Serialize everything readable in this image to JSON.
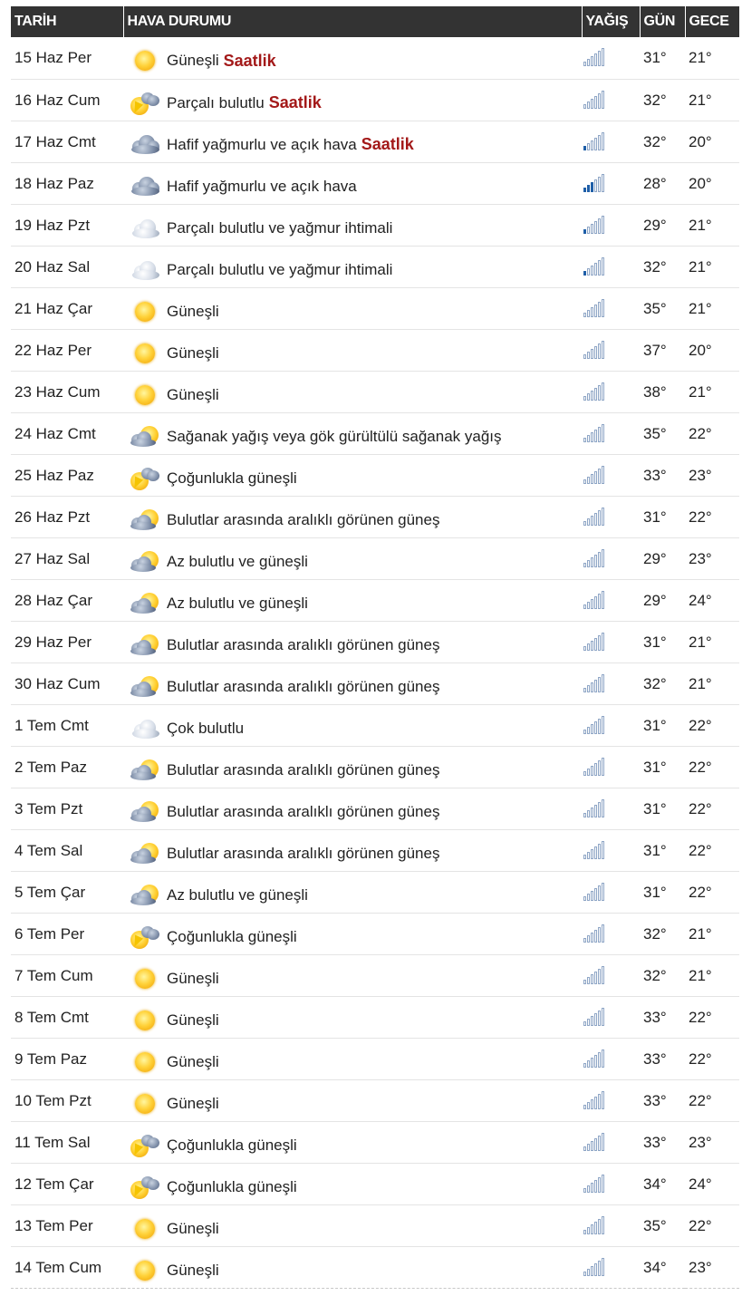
{
  "headers": {
    "date": "TARİH",
    "condition": "HAVA DURUMU",
    "rain": "YAĞIŞ",
    "day": "GÜN",
    "night": "GECE"
  },
  "hourly_link": "Saatlik",
  "rows": [
    {
      "date": "15 Haz Per",
      "icon": "sun-icon",
      "condition": "Güneşli",
      "hourly": true,
      "rain": 0,
      "day": "31°",
      "night": "21°"
    },
    {
      "date": "16 Haz Cum",
      "icon": "sun-cloud-storm-icon",
      "condition": "Parçalı bulutlu",
      "hourly": true,
      "rain": 0,
      "day": "32°",
      "night": "21°"
    },
    {
      "date": "17 Haz Cmt",
      "icon": "rain-cloud-icon",
      "condition": "Hafif yağmurlu ve açık hava",
      "hourly": true,
      "rain": 1,
      "day": "32°",
      "night": "20°"
    },
    {
      "date": "18 Haz Paz",
      "icon": "rain-cloud-icon",
      "condition": "Hafif yağmurlu ve açık hava",
      "hourly": false,
      "rain": 3,
      "day": "28°",
      "night": "20°"
    },
    {
      "date": "19 Haz Pzt",
      "icon": "cloud-icon",
      "condition": "Parçalı bulutlu ve yağmur ihtimali",
      "hourly": false,
      "rain": 1,
      "day": "29°",
      "night": "21°"
    },
    {
      "date": "20 Haz Sal",
      "icon": "cloud-icon",
      "condition": "Parçalı bulutlu ve yağmur ihtimali",
      "hourly": false,
      "rain": 1,
      "day": "32°",
      "night": "21°"
    },
    {
      "date": "21 Haz Çar",
      "icon": "sun-icon",
      "condition": "Güneşli",
      "hourly": false,
      "rain": 0,
      "day": "35°",
      "night": "21°"
    },
    {
      "date": "22 Haz Per",
      "icon": "sun-icon",
      "condition": "Güneşli",
      "hourly": false,
      "rain": 0,
      "day": "37°",
      "night": "20°"
    },
    {
      "date": "23 Haz Cum",
      "icon": "sun-icon",
      "condition": "Güneşli",
      "hourly": false,
      "rain": 0,
      "day": "38°",
      "night": "21°"
    },
    {
      "date": "24 Haz Cmt",
      "icon": "sun-dark-cloud-icon",
      "condition": "Sağanak yağış veya gök gürültülü sağanak yağış",
      "hourly": false,
      "rain": 0,
      "day": "35°",
      "night": "22°"
    },
    {
      "date": "25 Haz Paz",
      "icon": "sun-cloud-storm-icon",
      "condition": "Çoğunlukla güneşli",
      "hourly": false,
      "rain": 0,
      "day": "33°",
      "night": "23°"
    },
    {
      "date": "26 Haz Pzt",
      "icon": "sun-dark-cloud-icon",
      "condition": "Bulutlar arasında aralıklı görünen güneş",
      "hourly": false,
      "rain": 0,
      "day": "31°",
      "night": "22°"
    },
    {
      "date": "27 Haz Sal",
      "icon": "sun-dark-cloud-icon",
      "condition": "Az bulutlu ve güneşli",
      "hourly": false,
      "rain": 0,
      "day": "29°",
      "night": "23°"
    },
    {
      "date": "28 Haz Çar",
      "icon": "sun-dark-cloud-icon",
      "condition": "Az bulutlu ve güneşli",
      "hourly": false,
      "rain": 0,
      "day": "29°",
      "night": "24°"
    },
    {
      "date": "29 Haz Per",
      "icon": "sun-dark-cloud-icon",
      "condition": "Bulutlar arasında aralıklı görünen güneş",
      "hourly": false,
      "rain": 0,
      "day": "31°",
      "night": "21°"
    },
    {
      "date": "30 Haz Cum",
      "icon": "sun-dark-cloud-icon",
      "condition": "Bulutlar arasında aralıklı görünen güneş",
      "hourly": false,
      "rain": 0,
      "day": "32°",
      "night": "21°"
    },
    {
      "date": "1 Tem Cmt",
      "icon": "cloud-icon",
      "condition": "Çok bulutlu",
      "hourly": false,
      "rain": 0,
      "day": "31°",
      "night": "22°"
    },
    {
      "date": "2 Tem Paz",
      "icon": "sun-dark-cloud-icon",
      "condition": "Bulutlar arasında aralıklı görünen güneş",
      "hourly": false,
      "rain": 0,
      "day": "31°",
      "night": "22°"
    },
    {
      "date": "3 Tem Pzt",
      "icon": "sun-dark-cloud-icon",
      "condition": "Bulutlar arasında aralıklı görünen güneş",
      "hourly": false,
      "rain": 0,
      "day": "31°",
      "night": "22°"
    },
    {
      "date": "4 Tem Sal",
      "icon": "sun-dark-cloud-icon",
      "condition": "Bulutlar arasında aralıklı görünen güneş",
      "hourly": false,
      "rain": 0,
      "day": "31°",
      "night": "22°"
    },
    {
      "date": "5 Tem Çar",
      "icon": "sun-dark-cloud-icon",
      "condition": "Az bulutlu ve güneşli",
      "hourly": false,
      "rain": 0,
      "day": "31°",
      "night": "22°"
    },
    {
      "date": "6 Tem Per",
      "icon": "sun-cloud-storm-icon",
      "condition": "Çoğunlukla güneşli",
      "hourly": false,
      "rain": 0,
      "day": "32°",
      "night": "21°"
    },
    {
      "date": "7 Tem Cum",
      "icon": "sun-icon",
      "condition": "Güneşli",
      "hourly": false,
      "rain": 0,
      "day": "32°",
      "night": "21°"
    },
    {
      "date": "8 Tem Cmt",
      "icon": "sun-icon",
      "condition": "Güneşli",
      "hourly": false,
      "rain": 0,
      "day": "33°",
      "night": "22°"
    },
    {
      "date": "9 Tem Paz",
      "icon": "sun-icon",
      "condition": "Güneşli",
      "hourly": false,
      "rain": 0,
      "day": "33°",
      "night": "22°"
    },
    {
      "date": "10 Tem Pzt",
      "icon": "sun-icon",
      "condition": "Güneşli",
      "hourly": false,
      "rain": 0,
      "day": "33°",
      "night": "22°"
    },
    {
      "date": "11 Tem Sal",
      "icon": "sun-cloud-storm-icon",
      "condition": "Çoğunlukla güneşli",
      "hourly": false,
      "rain": 0,
      "day": "33°",
      "night": "23°"
    },
    {
      "date": "12 Tem Çar",
      "icon": "sun-cloud-storm-icon",
      "condition": "Çoğunlukla güneşli",
      "hourly": false,
      "rain": 0,
      "day": "34°",
      "night": "24°"
    },
    {
      "date": "13 Tem Per",
      "icon": "sun-icon",
      "condition": "Güneşli",
      "hourly": false,
      "rain": 0,
      "day": "35°",
      "night": "22°"
    },
    {
      "date": "14 Tem Cum",
      "icon": "sun-icon",
      "condition": "Güneşli",
      "hourly": false,
      "rain": 0,
      "day": "34°",
      "night": "23°"
    }
  ]
}
